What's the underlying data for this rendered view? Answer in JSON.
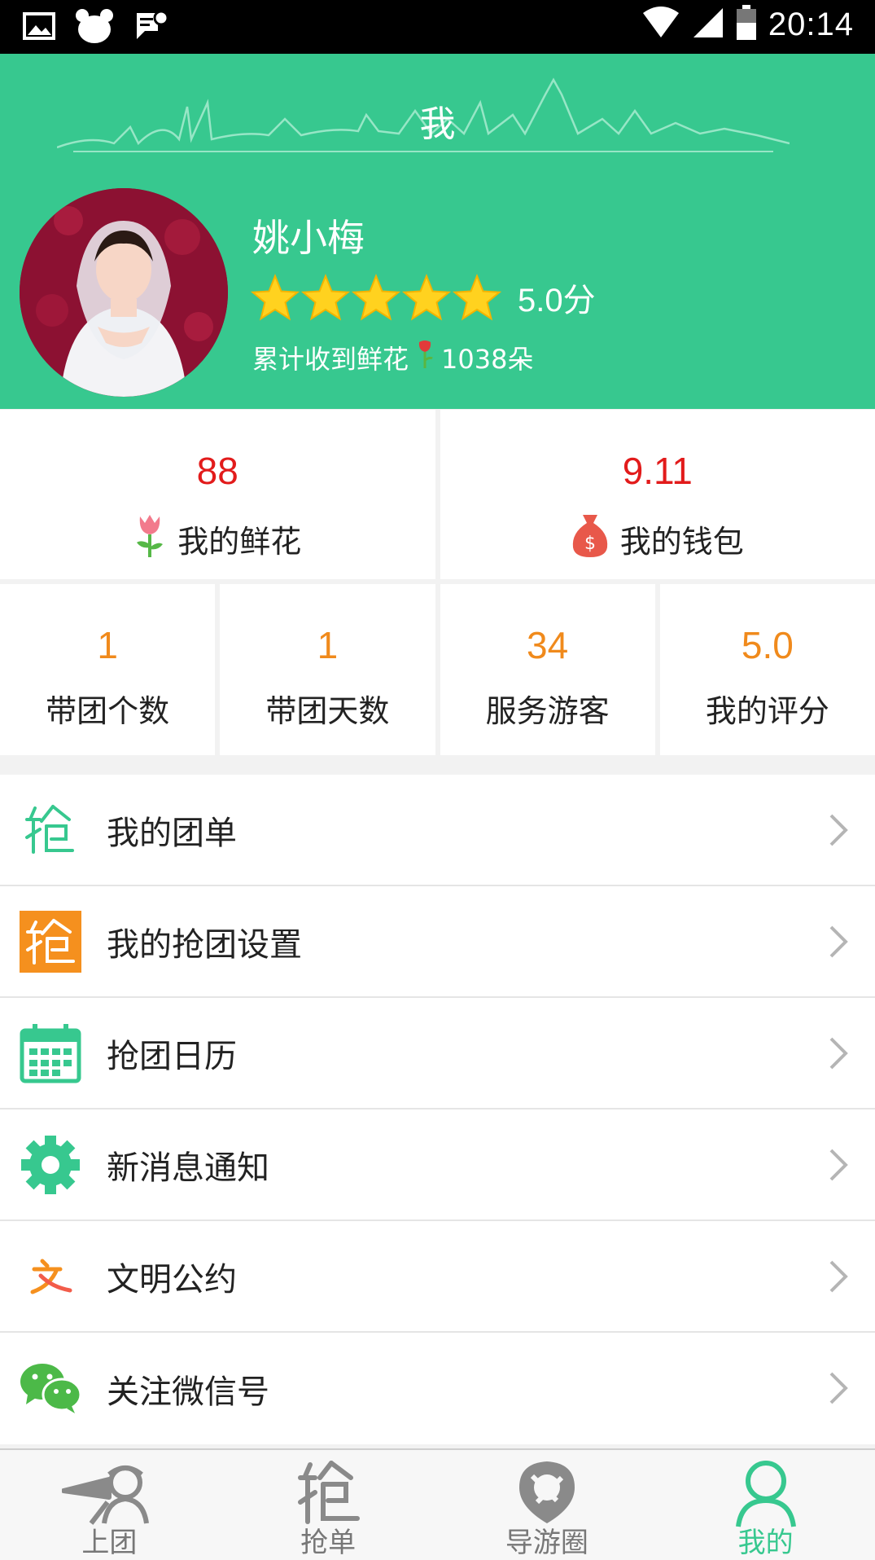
{
  "status_bar": {
    "time": "20:14",
    "icons": [
      "image-icon",
      "bear-icon",
      "message-icon",
      "wifi-icon",
      "signal-icon",
      "battery-icon"
    ]
  },
  "header": {
    "title": "我",
    "bg_color": "#37c88f",
    "profile": {
      "name": "姚小梅",
      "rating": 5,
      "rating_text": "5.0分",
      "flowers_prefix": "累计收到鲜花",
      "flowers_count": "1038朵"
    }
  },
  "summary": [
    {
      "value": "88",
      "label": "我的鲜花",
      "icon": "flower-icon"
    },
    {
      "value": "9.11",
      "label": "我的钱包",
      "icon": "money-bag-icon"
    }
  ],
  "stats": [
    {
      "value": "1",
      "label": "带团个数"
    },
    {
      "value": "1",
      "label": "带团天数"
    },
    {
      "value": "34",
      "label": "服务游客"
    },
    {
      "value": "5.0",
      "label": "我的评分"
    }
  ],
  "menu": [
    {
      "label": "我的团单",
      "icon": "grab-icon"
    },
    {
      "label": "我的抢团设置",
      "icon": "grab-settings-icon"
    },
    {
      "label": "抢团日历",
      "icon": "calendar-icon"
    },
    {
      "label": "新消息通知",
      "icon": "gear-icon"
    },
    {
      "label": "文明公约",
      "icon": "civility-icon"
    },
    {
      "label": "关注微信号",
      "icon": "wechat-icon"
    }
  ],
  "tabs": [
    {
      "label": "上团",
      "icon": "tour-guide-icon",
      "active": false
    },
    {
      "label": "抢单",
      "icon": "grab-order-icon",
      "active": false
    },
    {
      "label": "导游圈",
      "icon": "guide-circle-icon",
      "active": false
    },
    {
      "label": "我的",
      "icon": "person-icon",
      "active": true
    }
  ],
  "colors": {
    "accent": "#37c88f",
    "red_value": "#e21b1b",
    "orange_value": "#f08a1c",
    "star": "#ffd21f"
  }
}
